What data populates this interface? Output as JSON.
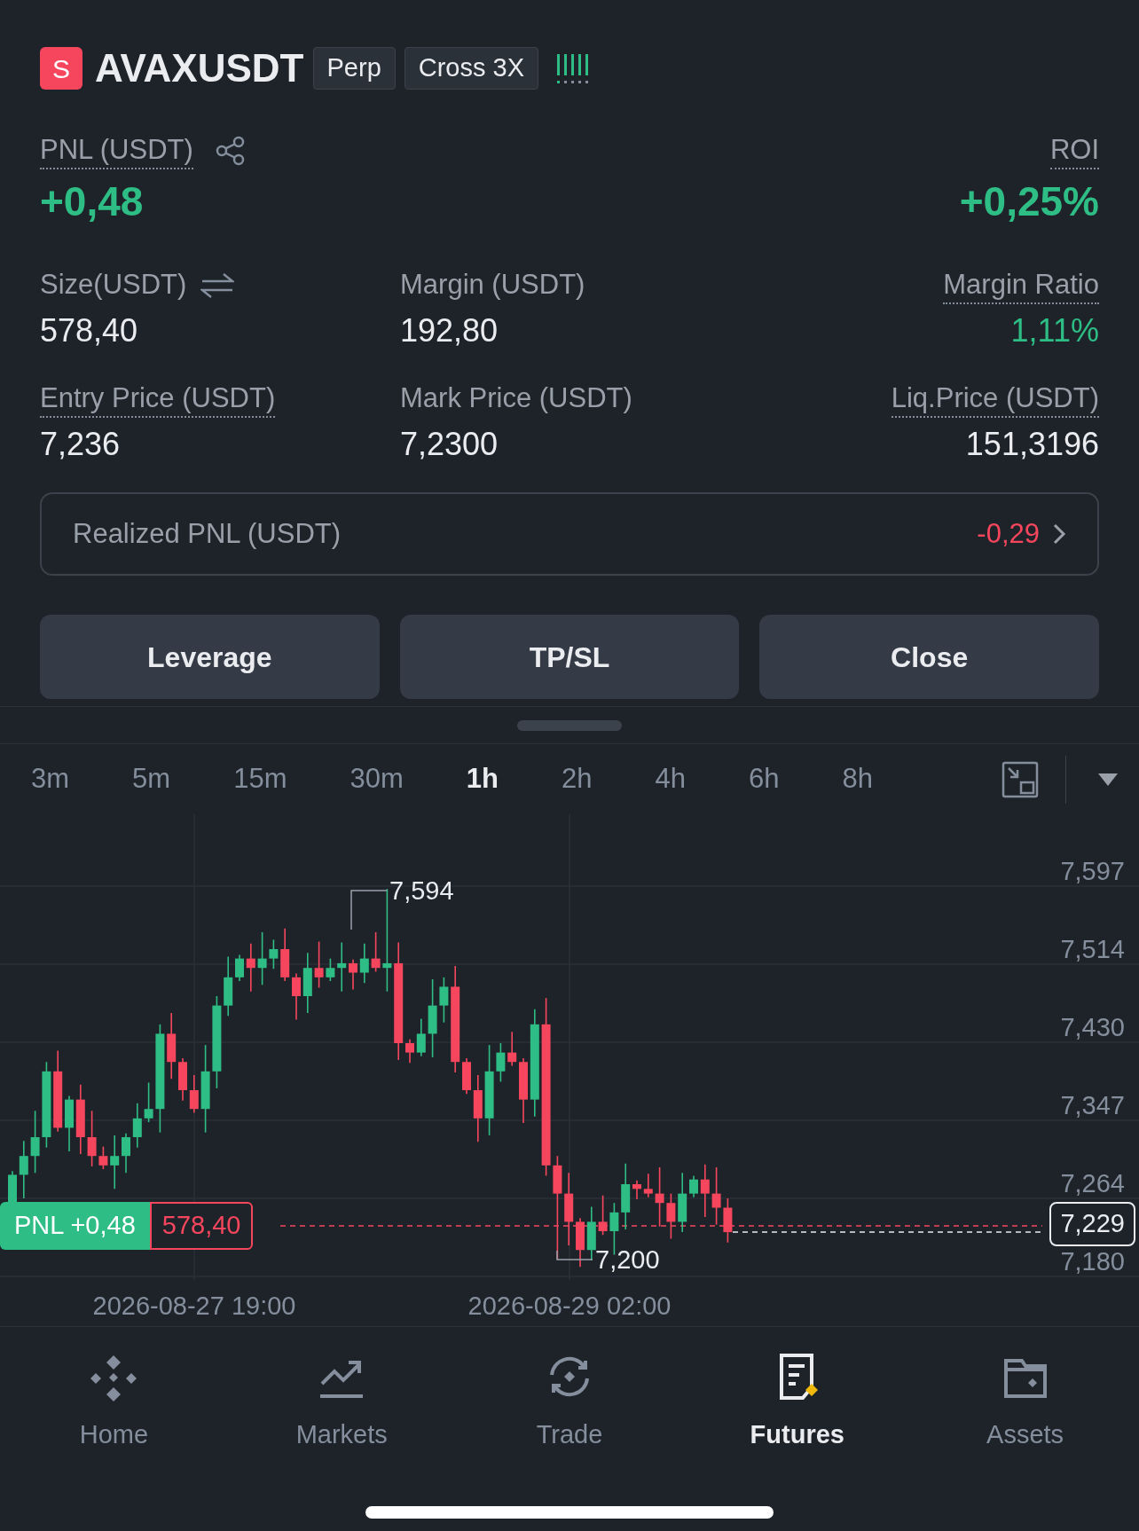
{
  "header": {
    "badge_letter": "S",
    "symbol": "AVAXUSDT",
    "tags": [
      "Perp",
      "Cross 3X"
    ]
  },
  "pnl": {
    "label": "PNL (USDT)",
    "value": "+0,48",
    "gain": true
  },
  "roi": {
    "label": "ROI",
    "value": "+0,25%",
    "gain": true
  },
  "stats": [
    {
      "label": "Size(USDT)",
      "value": "578,40",
      "underlined": false,
      "highlighted": false
    },
    {
      "label": "Margin (USDT)",
      "value": "192,80",
      "underlined": false,
      "highlighted": false
    },
    {
      "label": "Margin Ratio",
      "value": "1,11%",
      "underlined": true,
      "highlighted": true
    },
    {
      "label": "Entry Price (USDT)",
      "value": "7,236",
      "underlined": true,
      "highlighted": false
    },
    {
      "label": "Mark Price (USDT)",
      "value": "7,2300",
      "underlined": false,
      "highlighted": false
    },
    {
      "label": "Liq.Price (USDT)",
      "value": "151,3196",
      "underlined": true,
      "highlighted": false
    }
  ],
  "realized": {
    "label": "Realized PNL (USDT)",
    "value": "-0,29",
    "gain": false
  },
  "actions": [
    "Leverage",
    "TP/SL",
    "Close"
  ],
  "intervals": [
    {
      "label": "3m",
      "selected": false
    },
    {
      "label": "5m",
      "selected": false
    },
    {
      "label": "15m",
      "selected": false
    },
    {
      "label": "30m",
      "selected": false
    },
    {
      "label": "1h",
      "selected": true
    },
    {
      "label": "2h",
      "selected": false
    },
    {
      "label": "4h",
      "selected": false
    },
    {
      "label": "6h",
      "selected": false
    },
    {
      "label": "8h",
      "selected": false
    }
  ],
  "chart": {
    "y_labels": [
      "7,597",
      "7,514",
      "7,430",
      "7,347",
      "7,264",
      "7,180"
    ],
    "x_labels": [
      "2026-08-27 19:00",
      "2026-08-29 02:00"
    ],
    "high_label": "7,594",
    "low_label": "7,200",
    "pnl_tag": "PNL +0,48",
    "size_tag": "578,40",
    "last_price": "7,229"
  },
  "nav": [
    {
      "label": "Home",
      "selected": false
    },
    {
      "label": "Markets",
      "selected": false
    },
    {
      "label": "Trade",
      "selected": false
    },
    {
      "label": "Futures",
      "selected": true
    },
    {
      "label": "Assets",
      "selected": false
    }
  ]
}
